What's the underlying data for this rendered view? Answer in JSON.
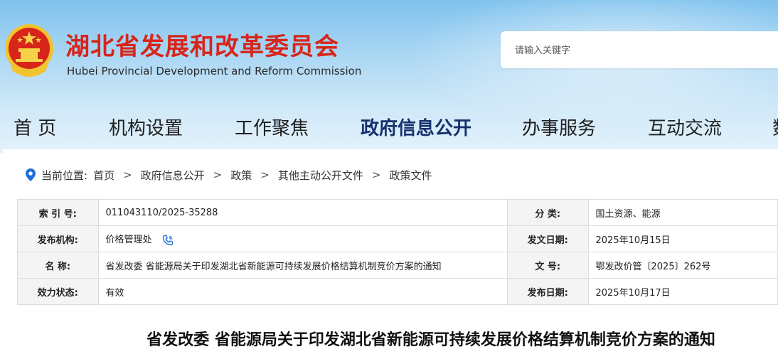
{
  "header": {
    "title": "湖北省发展和改革委员会",
    "subtitle": "Hubei Provincial Development and Reform Commission",
    "emblem_icon": "national-emblem-icon",
    "brand_color": "#d8251a"
  },
  "search": {
    "placeholder": "请输入关键字"
  },
  "nav": {
    "items": [
      {
        "label": "首 页"
      },
      {
        "label": "机构设置"
      },
      {
        "label": "工作聚焦"
      },
      {
        "label": "政府信息公开",
        "active": true
      },
      {
        "label": "办事服务"
      },
      {
        "label": "互动交流"
      },
      {
        "label": "数"
      }
    ],
    "active_color": "#17316e"
  },
  "breadcrumb": {
    "prefix": "当前位置:",
    "items": [
      "首页",
      "政府信息公开",
      "政策",
      "其他主动公开文件",
      "政策文件"
    ],
    "separator": ">",
    "icon": "location-pin-icon"
  },
  "meta_table": {
    "rows": [
      {
        "label1": "索 引 号:",
        "value1": "011043110/2025-35288",
        "label2": "分      类:",
        "value2": "国土资源、能源"
      },
      {
        "label1": "发布机构:",
        "value1": "价格管理处",
        "label2": "发文日期:",
        "value2": "2025年10月15日"
      },
      {
        "label1": "名      称:",
        "value1": "省发改委 省能源局关于印发湖北省新能源可持续发展价格结算机制竞价方案的通知",
        "label2": "文      号:",
        "value2": "鄂发改价管〔2025〕262号"
      },
      {
        "label1": "效力状态:",
        "value1": "有效",
        "label2": "发布日期:",
        "value2": "2025年10月17日"
      }
    ],
    "phone_icon": "phone-icon"
  },
  "document": {
    "title": "省发改委 省能源局关于印发湖北省新能源可持续发展价格结算机制竞价方案的通知"
  }
}
